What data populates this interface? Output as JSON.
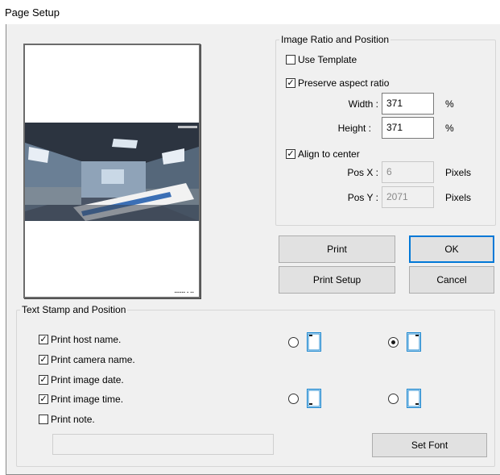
{
  "window": {
    "title": "Page Setup"
  },
  "image_group": {
    "legend": "Image Ratio and Position",
    "use_template": {
      "label": "Use Template",
      "checked": false
    },
    "preserve_aspect": {
      "label": "Preserve aspect ratio",
      "checked": true
    },
    "width": {
      "label": "Width :",
      "value": "371",
      "unit": "%"
    },
    "height": {
      "label": "Height :",
      "value": "371",
      "unit": "%"
    },
    "align_center": {
      "label": "Align to center",
      "checked": true
    },
    "pos_x": {
      "label": "Pos X :",
      "value": "6",
      "unit": "Pixels"
    },
    "pos_y": {
      "label": "Pos Y :",
      "value": "2071",
      "unit": "Pixels"
    }
  },
  "buttons": {
    "print": "Print",
    "ok": "OK",
    "print_setup": "Print Setup",
    "cancel": "Cancel",
    "set_font": "Set Font"
  },
  "text_group": {
    "legend": "Text Stamp and Position",
    "items": [
      {
        "label": "Print host name.",
        "checked": true
      },
      {
        "label": "Print camera name.",
        "checked": true
      },
      {
        "label": "Print image date.",
        "checked": true
      },
      {
        "label": "Print image time.",
        "checked": true
      },
      {
        "label": "Print note.",
        "checked": false
      }
    ],
    "note_value": "",
    "positions": [
      {
        "name": "top-left",
        "selected": false
      },
      {
        "name": "top-right",
        "selected": true
      },
      {
        "name": "bottom-left",
        "selected": false
      },
      {
        "name": "bottom-right",
        "selected": false
      }
    ]
  },
  "colors": {
    "default_button_border": "#0078d7",
    "panel_bg": "#f0f0f0",
    "icon_blue": "#1e88d0"
  }
}
